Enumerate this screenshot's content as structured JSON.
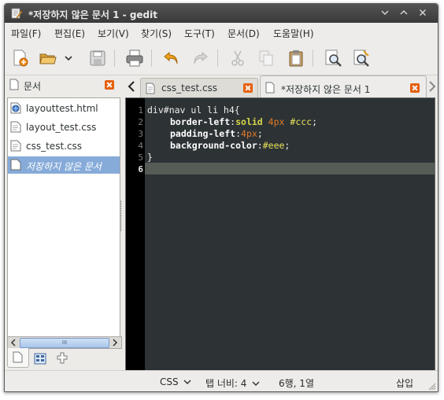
{
  "window": {
    "title": "*저장하지 않은 문서 1 - gedit",
    "controls": [
      "chevron-down",
      "chevron-up",
      "close"
    ]
  },
  "menubar": {
    "items": [
      "파일(F)",
      "편집(E)",
      "보기(V)",
      "찾기(S)",
      "도구(T)",
      "문서(D)",
      "도움말(H)"
    ]
  },
  "toolbar": {
    "buttons": [
      "new-document-icon",
      "open-icon",
      "open-dropdown-icon",
      "save-icon",
      "print-icon",
      "undo-icon",
      "redo-icon",
      "cut-icon",
      "copy-icon",
      "paste-icon",
      "find-icon",
      "find-replace-icon"
    ]
  },
  "side_panel": {
    "title": "문서",
    "documents": [
      {
        "name": "layouttest.html",
        "icon": "html-file-icon"
      },
      {
        "name": "layout_test.css",
        "icon": "text-file-icon"
      },
      {
        "name": "css_test.css",
        "icon": "text-file-icon"
      },
      {
        "name": "저장하지 않은 문서",
        "icon": "text-file-icon",
        "selected": true
      }
    ],
    "scroll_thumb_label": "III"
  },
  "tabs": [
    {
      "label": "css_test.css",
      "active": false
    },
    {
      "label": "*저장하지 않은 문서 1",
      "active": true
    }
  ],
  "editor": {
    "line_numbers": [
      "1",
      "2",
      "3",
      "4",
      "5",
      "6"
    ],
    "current_line": 6,
    "lines": [
      {
        "t": "div#nav ul li h4{"
      },
      {
        "prop": "border-left",
        "colon": ":",
        "val": "solid",
        "sp": " ",
        "num": "4px",
        "sp2": " ",
        "colr": "#ccc",
        "end": ";"
      },
      {
        "prop": "padding-left",
        "colon": ":",
        "num": "4px",
        "end": ";"
      },
      {
        "prop": "background-color",
        "colon": ":",
        "colr": "#eee",
        "end": ";"
      },
      {
        "t": "}"
      },
      {
        "t": ""
      }
    ]
  },
  "statusbar": {
    "language": "CSS",
    "tab_width": "탭 너비: 4",
    "position": "6행, 1열",
    "mode": "삽입"
  },
  "colors": {
    "titlebar": "#3f3f3f",
    "editor_bg": "#2d3235",
    "selection": "#86abd9",
    "current_line": "#565d57",
    "close_orange": "#e5600c"
  }
}
